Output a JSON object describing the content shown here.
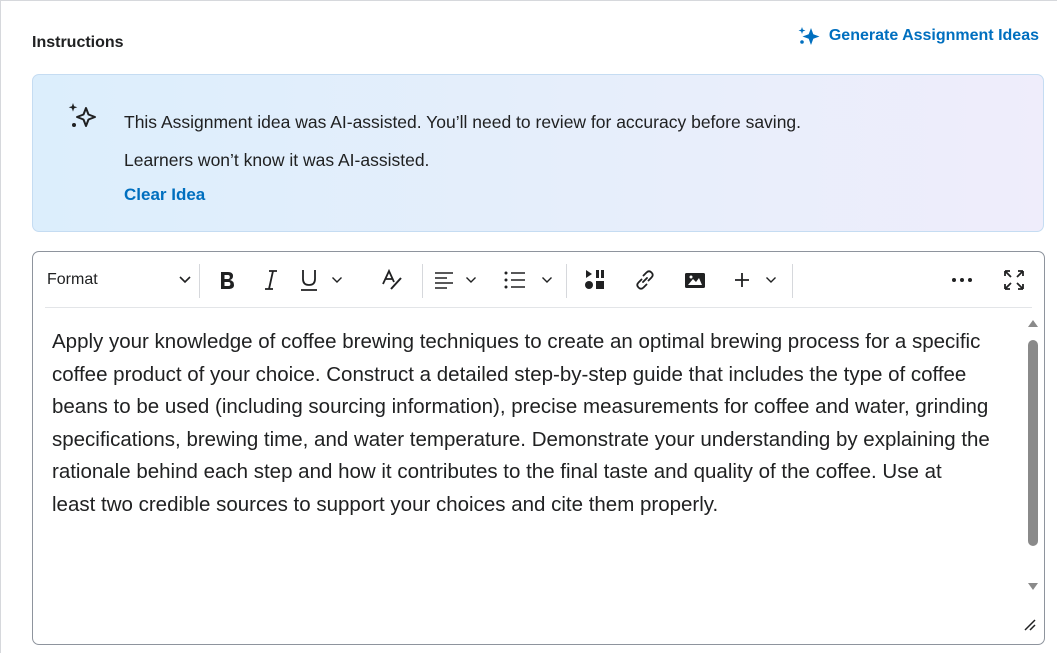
{
  "section": {
    "label": "Instructions",
    "generate_link": "Generate Assignment Ideas"
  },
  "banner": {
    "line1": "This Assignment idea was AI-assisted. You’ll need to review for accuracy before saving.",
    "line2": "Learners won’t know it was AI-assisted.",
    "clear_link": "Clear Idea"
  },
  "toolbar": {
    "format_label": "Format",
    "icons": [
      "chevron-down-icon",
      "bold-icon",
      "italic-icon",
      "underline-icon",
      "text-color-icon",
      "align-icon",
      "list-icon",
      "insert-stuff-icon",
      "link-icon",
      "image-icon",
      "plus-icon",
      "more-icon",
      "fullscreen-icon"
    ]
  },
  "editor": {
    "content": "Apply your knowledge of coffee brewing techniques to create an optimal brewing process for a specific coffee product of your choice. Construct a detailed step-by-step guide that includes the type of coffee beans to be used (including sourcing information), precise measurements for coffee and water, grinding specifications, brewing time, and water temperature. Demonstrate your understanding by explaining the rationale behind each step and how it contributes to the final taste and quality of the coffee. Use at least two credible sources to support your choices and cite them properly."
  },
  "colors": {
    "link": "#006fbf",
    "banner_border": "#c5dcf2",
    "text": "#202122"
  }
}
